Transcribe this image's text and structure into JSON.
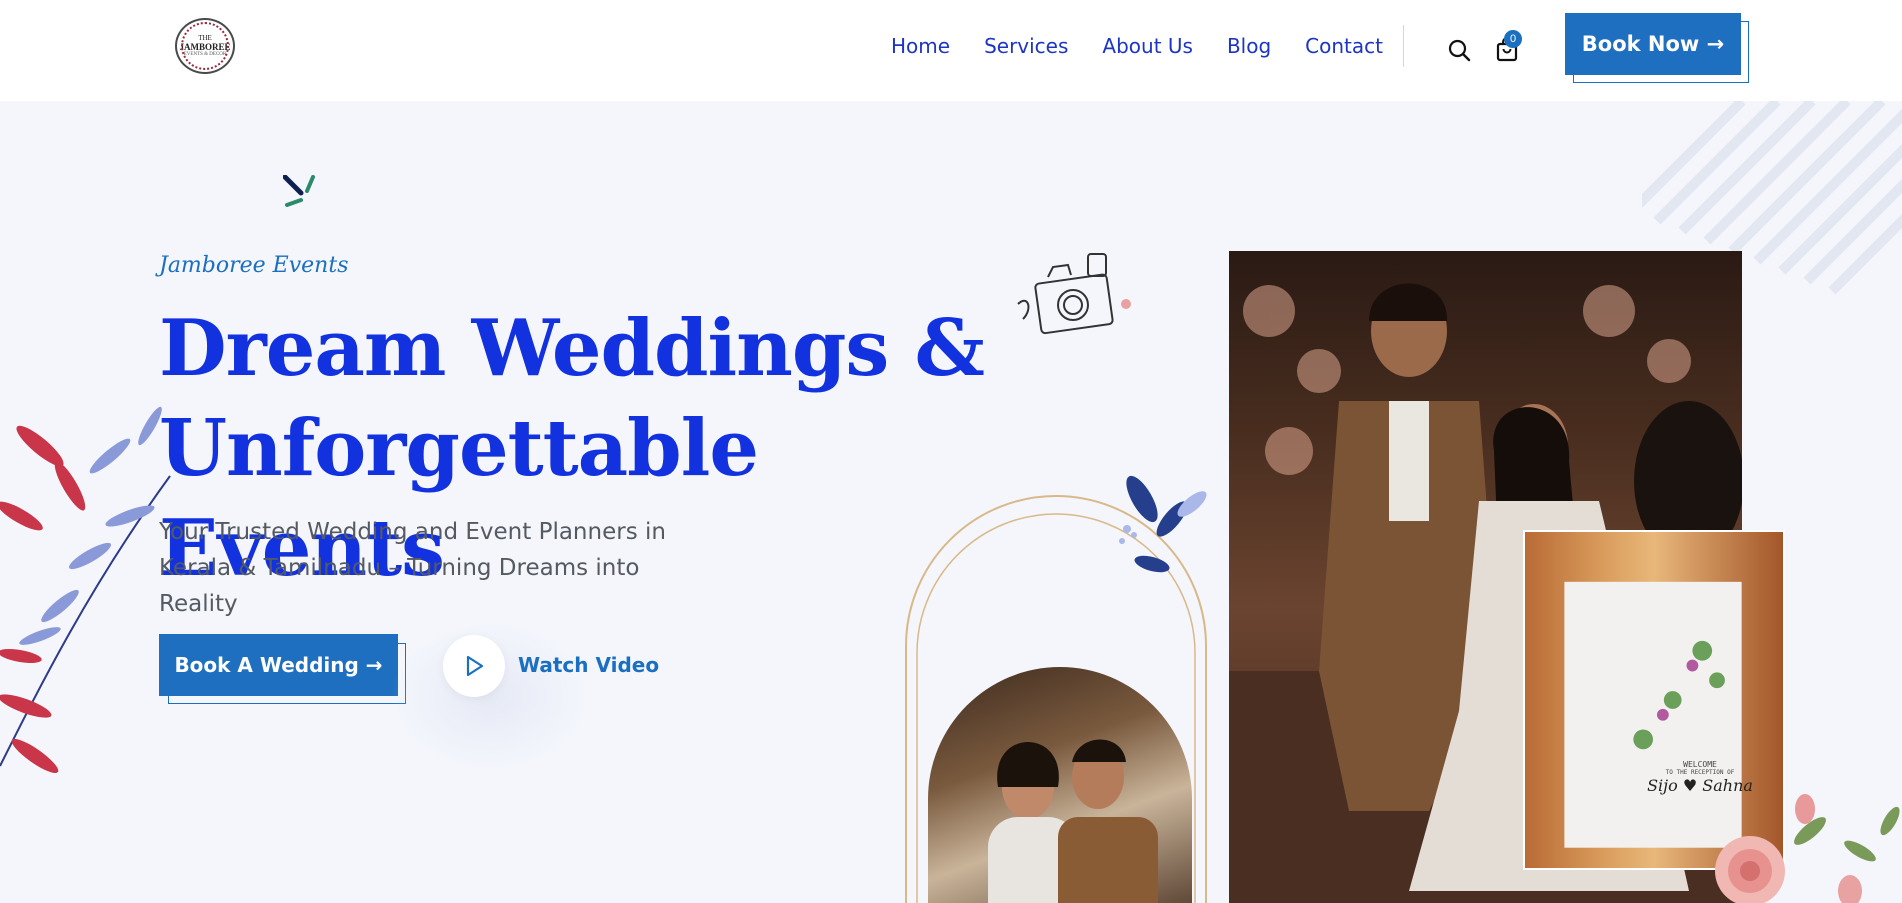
{
  "brand": {
    "logo_line1": "THE",
    "logo_line2": "JAMBOREE",
    "logo_line3": "EVENTS & DECOR"
  },
  "nav": {
    "items": [
      "Home",
      "Services",
      "About Us",
      "Blog",
      "Contact"
    ],
    "cart_count": "0",
    "book_now_label": "Book Now →"
  },
  "hero": {
    "eyebrow": "Jamboree Events",
    "headline_line1": "Dream Weddings &",
    "headline_line2": "Unforgettable Events",
    "subtitle_line1": "Your Trusted Wedding and Event Planners in",
    "subtitle_line2": "Kerala & Tamilnadu – Turning Dreams into Reality",
    "cta_label": "Book A Wedding →",
    "watch_label": "Watch Video"
  },
  "signage": {
    "line1": "WELCOME",
    "line2": "TO THE RECEPTION OF",
    "line3": "Sijo ♥ Sahna"
  },
  "colors": {
    "primary": "#1e6fbf",
    "headline": "#1231df",
    "nav": "#1c35c4",
    "background": "#f4f6fc"
  },
  "icons": [
    "search-icon",
    "cart-icon",
    "play-icon",
    "arrow-right-icon",
    "camera-illustration",
    "leaf-decoration",
    "flower-decoration"
  ]
}
